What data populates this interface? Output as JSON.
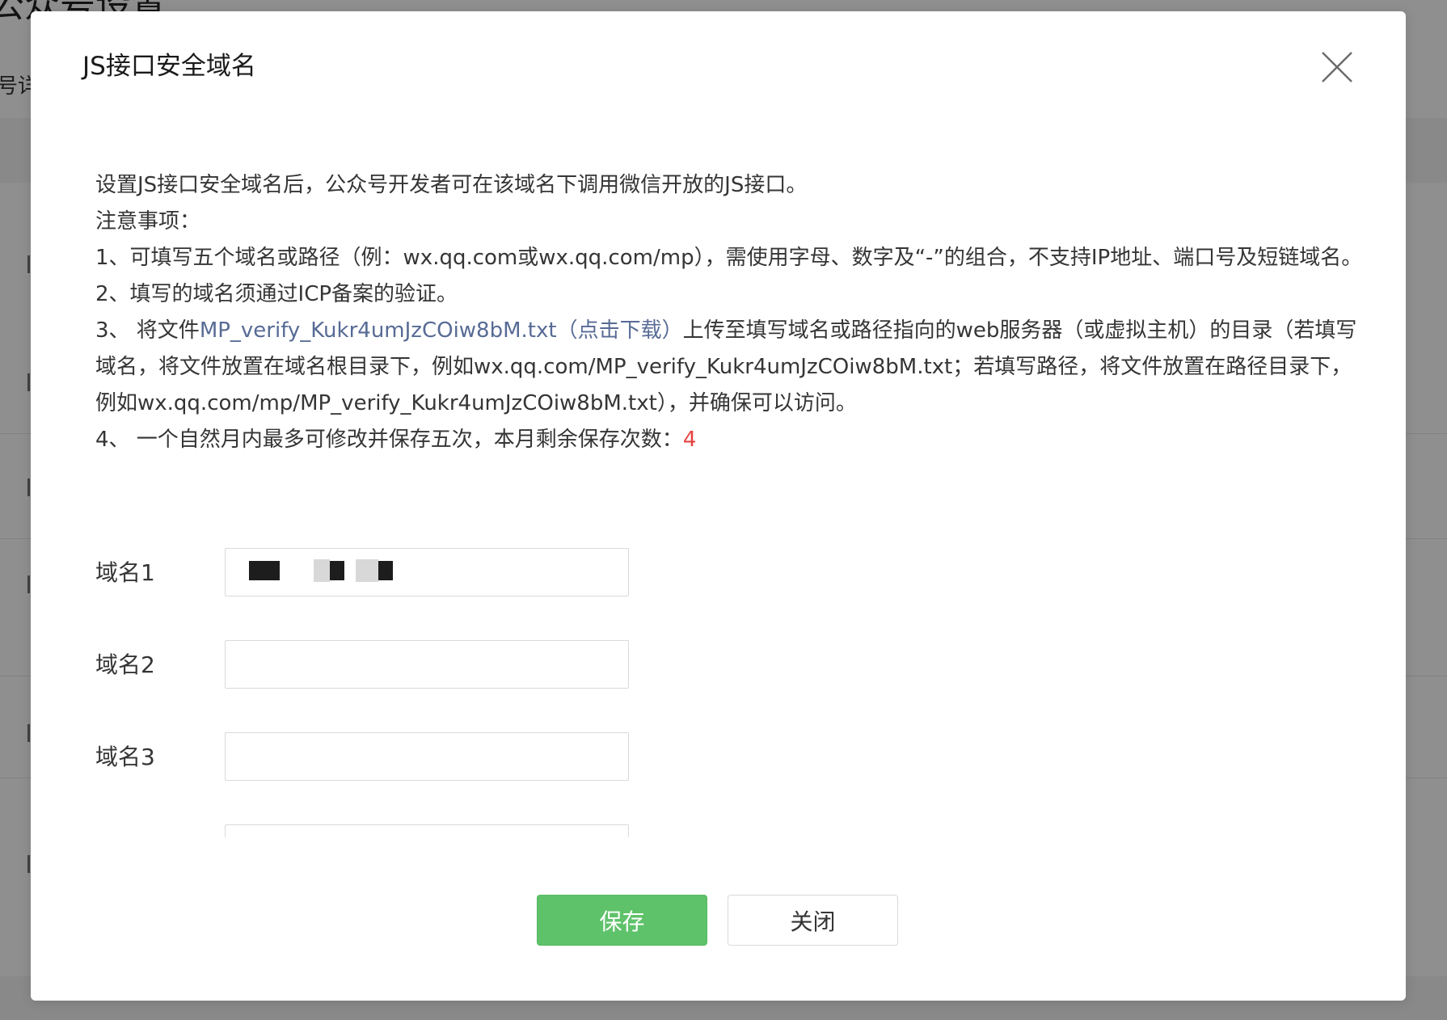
{
  "background_page": {
    "title": "公众号设置",
    "tab_fragment": "号详"
  },
  "dialog": {
    "title": "JS接口安全域名",
    "close_icon": "close-icon",
    "intro": "设置JS接口安全域名后，公众号开发者可在该域名下调用微信开放的JS接口。",
    "notes_heading": "注意事项：",
    "note1": "1、可填写五个域名或路径（例：wx.qq.com或wx.qq.com/mp），需使用字母、数字及“-”的组合，不支持IP地址、端口号及短链域名。",
    "note2": "2、填写的域名须通过ICP备案的验证。",
    "note3_prefix": "3、 将文件",
    "note3_file": "MP_verify_Kukr4umJzCOiw8bM.txt",
    "note3_download": "（点击下载）",
    "note3_suffix": "上传至填写域名或路径指向的web服务器（或虚拟主机）的目录（若填写域名，将文件放置在域名根目录下，例如wx.qq.com/MP_verify_Kukr4umJzCOiw8bM.txt；若填写路径，将文件放置在路径目录下，例如wx.qq.com/mp/MP_verify_Kukr4umJzCOiw8bM.txt），并确保可以访问。",
    "note4_prefix": "4、 一个自然月内最多可修改并保存五次，本月剩余保存次数：",
    "note4_count": "4",
    "fields": [
      {
        "label": "域名1",
        "value": ""
      },
      {
        "label": "域名2",
        "value": ""
      },
      {
        "label": "域名3",
        "value": ""
      },
      {
        "label": "",
        "value": ""
      }
    ],
    "save_label": "保存",
    "close_label": "关闭"
  },
  "colors": {
    "primary_button": "#5ec26a",
    "link": "#576b95",
    "count_highlight": "#e64340",
    "overlay": "rgba(0,0,0,0.44)"
  }
}
